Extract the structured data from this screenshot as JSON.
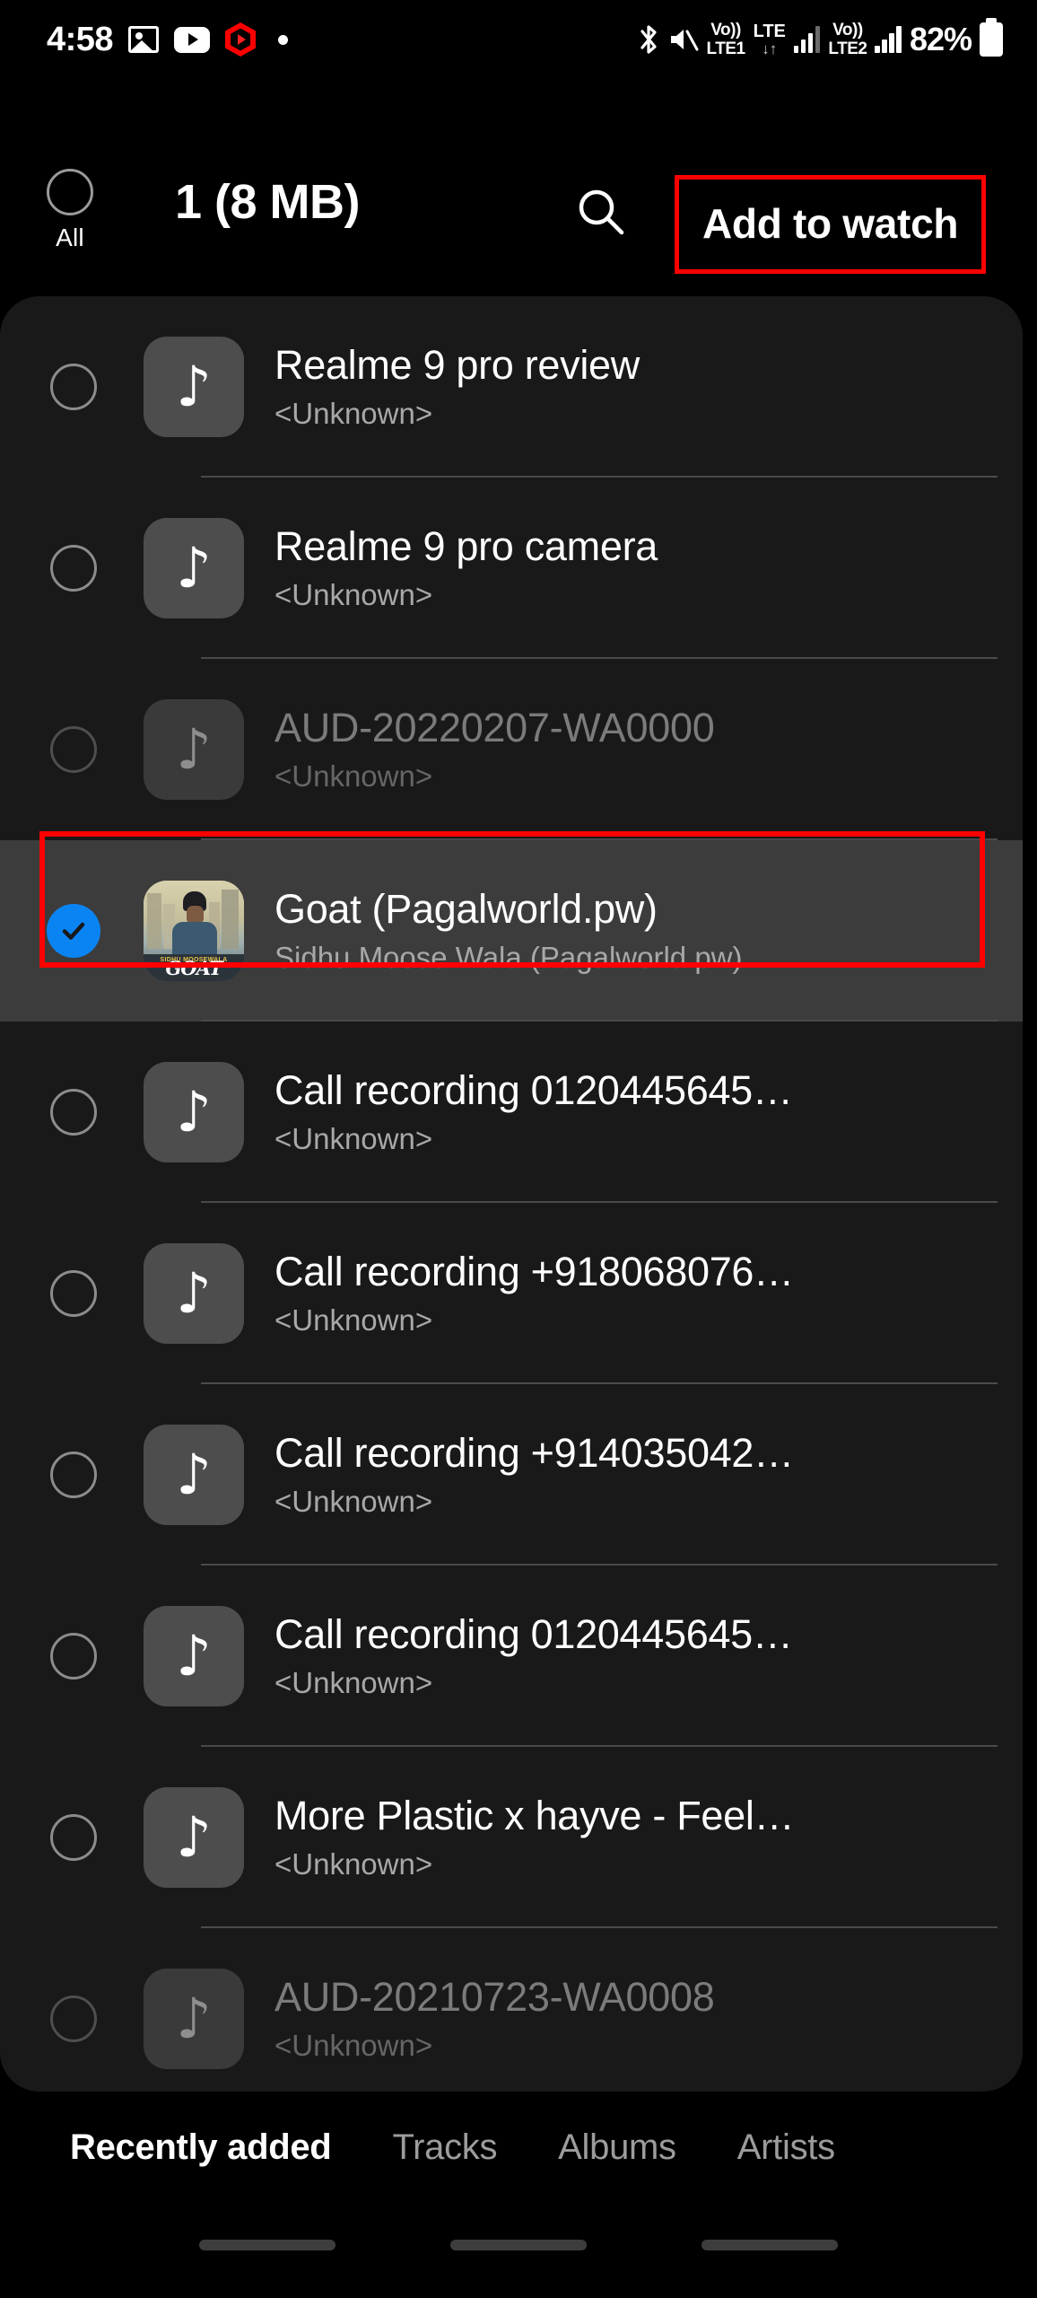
{
  "status_bar": {
    "time": "4:58",
    "left_icons": [
      "gallery-icon",
      "youtube-icon",
      "youtube-music-icon",
      "dot-icon"
    ],
    "right_icons": [
      "bluetooth-icon",
      "mute-icon",
      "volte1-icon",
      "lte-data-icon",
      "signal-bars-1-icon",
      "volte2-icon",
      "signal-bars-2-icon"
    ],
    "volte1_top": "Vo))",
    "volte1_bottom": "LTE1",
    "lte_label": "LTE",
    "lte_arrows": "↓↑",
    "volte2_top": "Vo))",
    "volte2_bottom": "LTE2",
    "battery_percent": "82%"
  },
  "header": {
    "all_label": "All",
    "title": "1 (8 MB)",
    "search_icon": "search-icon",
    "add_to_watch_label": "Add to watch",
    "highlight_color": "#ff0000"
  },
  "list": {
    "items": [
      {
        "title": "Realme 9 pro review",
        "subtitle": "<Unknown>",
        "checked": false,
        "dimmed": false,
        "thumb": "music-note-icon"
      },
      {
        "title": "Realme 9 pro camera",
        "subtitle": "<Unknown>",
        "checked": false,
        "dimmed": false,
        "thumb": "music-note-icon"
      },
      {
        "title": "AUD-20220207-WA0000",
        "subtitle": "<Unknown>",
        "checked": false,
        "dimmed": true,
        "thumb": "music-note-icon"
      },
      {
        "title": "Goat (Pagalworld.pw)",
        "subtitle": "Sidhu Moose Wala (Pagalworld.pw)",
        "checked": true,
        "dimmed": false,
        "thumb": "album-art",
        "art_top_text": "SIDHU MOOSEWALA",
        "art_bottom_text": "GOAT"
      },
      {
        "title": "Call recording 0120445645…",
        "subtitle": "<Unknown>",
        "checked": false,
        "dimmed": false,
        "thumb": "music-note-icon"
      },
      {
        "title": "Call recording +918068076…",
        "subtitle": "<Unknown>",
        "checked": false,
        "dimmed": false,
        "thumb": "music-note-icon"
      },
      {
        "title": "Call recording +914035042…",
        "subtitle": "<Unknown>",
        "checked": false,
        "dimmed": false,
        "thumb": "music-note-icon"
      },
      {
        "title": "Call recording 0120445645…",
        "subtitle": "<Unknown>",
        "checked": false,
        "dimmed": false,
        "thumb": "music-note-icon"
      },
      {
        "title": "More Plastic x hayve - Feel…",
        "subtitle": "<Unknown>",
        "checked": false,
        "dimmed": false,
        "thumb": "music-note-icon"
      },
      {
        "title": "AUD-20210723-WA0008",
        "subtitle": "<Unknown>",
        "checked": false,
        "dimmed": true,
        "thumb": "music-note-icon"
      }
    ],
    "selected_accent": "#0b84f3",
    "music_note_glyph": "♪"
  },
  "tabs": [
    {
      "label": "Recently added",
      "active": true
    },
    {
      "label": "Tracks",
      "active": false
    },
    {
      "label": "Albums",
      "active": false
    },
    {
      "label": "Artists",
      "active": false
    }
  ]
}
